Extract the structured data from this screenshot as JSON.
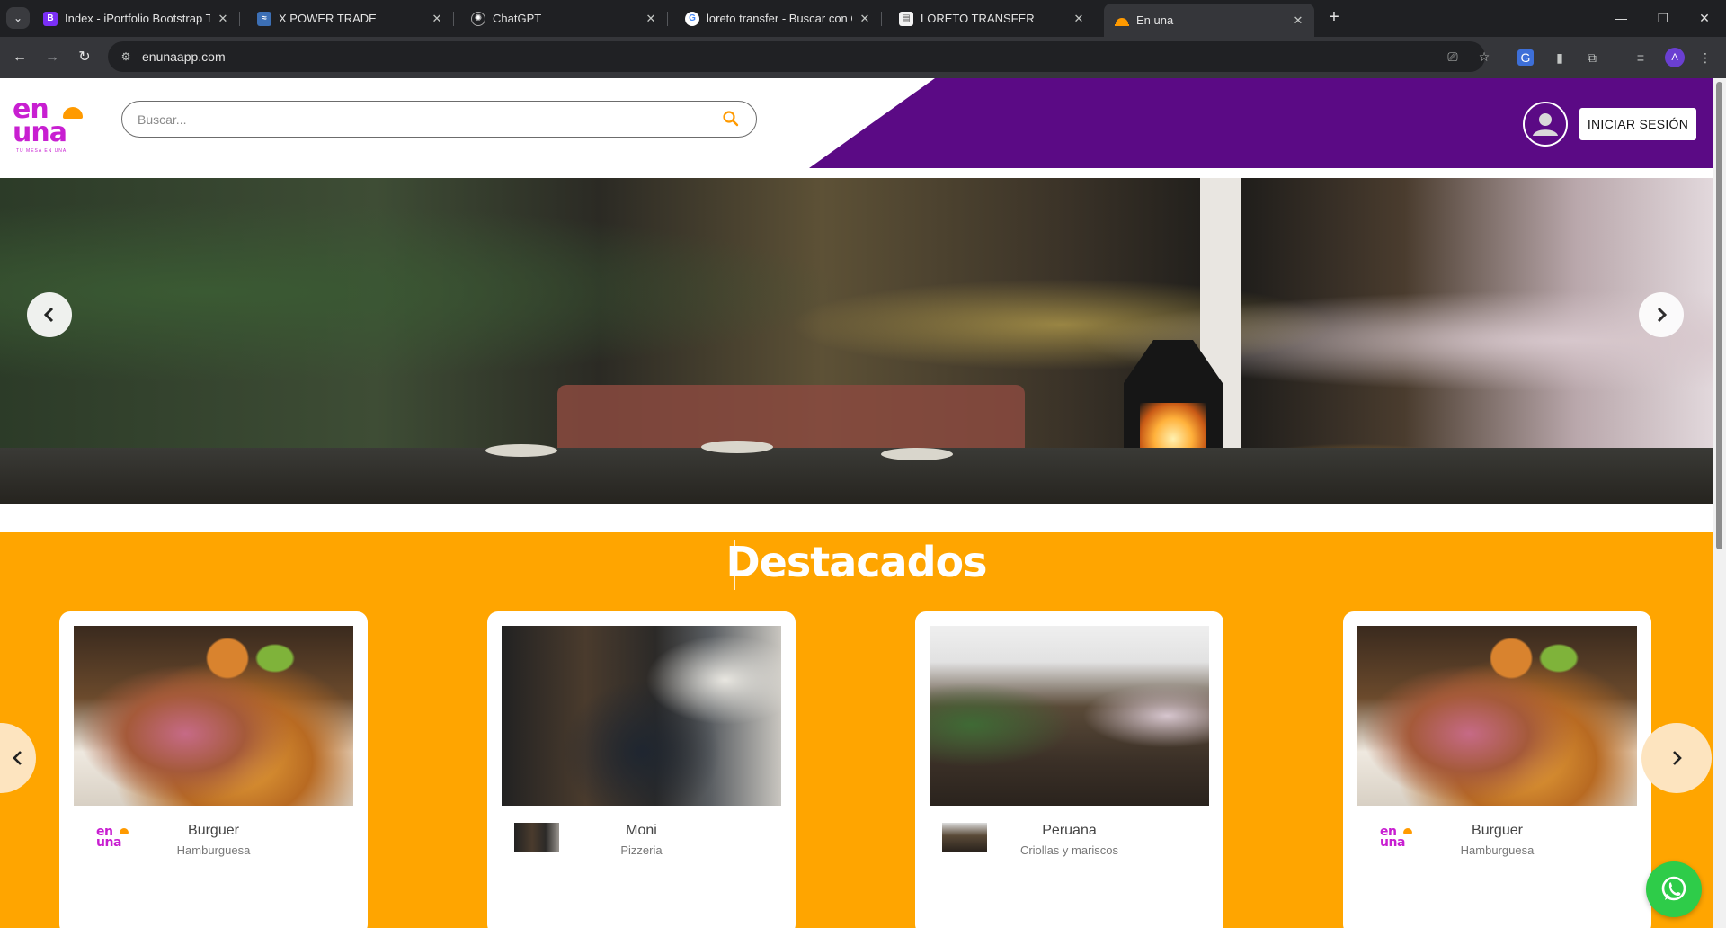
{
  "browser": {
    "tabs": [
      {
        "title": "Index - iPortfolio Bootstrap Tem",
        "favicon": "bootstrap-icon"
      },
      {
        "title": "X POWER TRADE",
        "favicon": "trade-icon"
      },
      {
        "title": "ChatGPT",
        "favicon": "chatgpt-icon"
      },
      {
        "title": "loreto transfer - Buscar con Goo",
        "favicon": "google-icon"
      },
      {
        "title": "LORETO TRANSFER",
        "favicon": "document-icon"
      },
      {
        "title": "En una",
        "favicon": "enuna-icon",
        "active": true
      }
    ],
    "url": "enunaapp.com",
    "profile_initial": "A"
  },
  "header": {
    "logo_top": "en",
    "logo_bottom": "una",
    "logo_tagline": "TU MESA EN UNA",
    "search_placeholder": "Buscar...",
    "login_label": "INICIAR SESIÓN",
    "colors": {
      "brand_purple": "#5b0a85",
      "brand_magenta": "#c81fd1",
      "accent_orange": "#ffa500"
    }
  },
  "featured": {
    "title": "Destacados",
    "cards": [
      {
        "name": "Burguer",
        "category": "Hamburguesa",
        "thumb": "enuna-logo"
      },
      {
        "name": "Moni",
        "category": "Pizzeria",
        "thumb": "restaurant-photo"
      },
      {
        "name": "Peruana",
        "category": "Criollas y mariscos",
        "thumb": "restaurant-photo"
      },
      {
        "name": "Burguer",
        "category": "Hamburguesa",
        "thumb": "enuna-logo"
      }
    ]
  }
}
